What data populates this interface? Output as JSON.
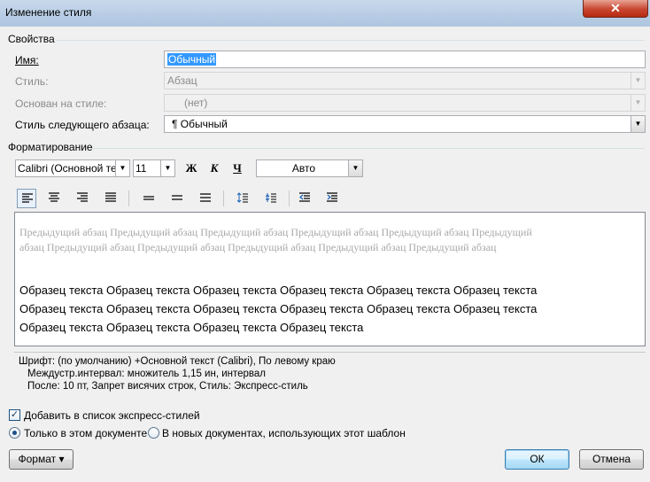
{
  "window": {
    "title": "Изменение стиля",
    "close_glyph": "✕"
  },
  "properties": {
    "group_label": "Свойства",
    "name_label": "Имя:",
    "name_value": "Обычный",
    "style_type_label": "Стиль:",
    "style_type_value": "Абзац",
    "based_on_label": "Основан на стиле:",
    "based_on_value": "(нет)",
    "next_style_label": "Стиль следующего абзаца:",
    "next_style_value": "¶ Обычный"
  },
  "formatting": {
    "group_label": "Форматирование",
    "font_name": "Calibri (Основной текс",
    "font_size": "11",
    "bold": "Ж",
    "italic": "К",
    "underline": "Ч",
    "color": "Авто"
  },
  "preview": {
    "previous_paragraph": "Предыдущий абзац Предыдущий абзац Предыдущий абзац Предыдущий абзац Предыдущий абзац Предыдущий абзац Предыдущий абзац Предыдущий абзац Предыдущий абзац Предыдущий абзац Предыдущий абзац",
    "sample_lines": [
      "Образец текста Образец текста Образец текста Образец текста Образец текста Образец текста",
      "Образец текста Образец текста Образец текста Образец текста Образец текста Образец текста",
      "Образец текста Образец текста Образец текста Образец текста"
    ]
  },
  "description": {
    "line1": "Шрифт: (по умолчанию) +Основной текст (Calibri), По левому краю",
    "line2": "Междустр.интервал:  множитель 1,15 ин, интервал",
    "line3": "После:  10 пт, Запрет висячих строк, Стиль: Экспресс-стиль"
  },
  "options": {
    "add_to_quick_styles": "Добавить в список экспресс-стилей",
    "add_to_quick_styles_checked": true,
    "only_this_document": "Только в этом документе",
    "new_documents_template": "В новых документах, использующих этот шаблон",
    "selected_scope": "only_this_document"
  },
  "buttons": {
    "format": "Формат",
    "ok": "ОК",
    "cancel": "Отмена"
  },
  "icons": {
    "dropdown": "▼",
    "checkmark": "✓",
    "format_menu_arrow": "▾"
  },
  "colors": {
    "selection": "#3399ff",
    "preview_previous": "#a8a8a8",
    "titlebar": "#b7cce4",
    "close": "#c8452f"
  }
}
